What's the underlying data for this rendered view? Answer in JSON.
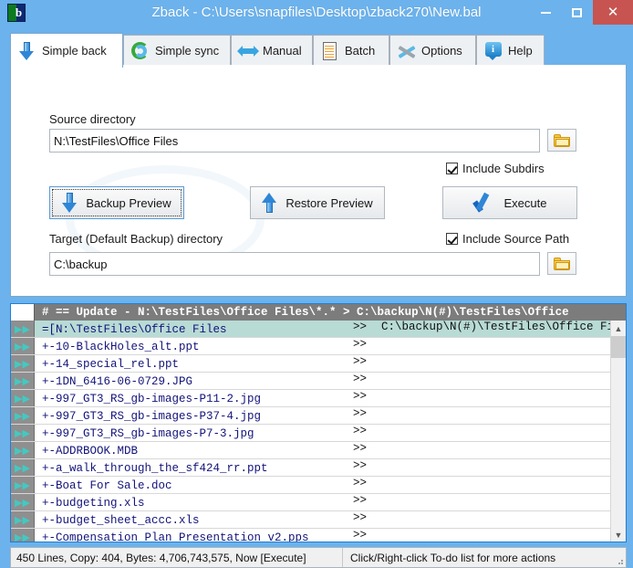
{
  "window": {
    "title": "Zback - C:\\Users\\snapfiles\\Desktop\\zback270\\New.bal",
    "minimize_label": "–",
    "maximize_label": "□",
    "close_label": "✕",
    "app_icon": "zback-app-icon"
  },
  "tabs": [
    {
      "label": "Simple back",
      "icon": "down-arrow-icon",
      "active": true
    },
    {
      "label": "Simple sync",
      "icon": "sync-arrows-icon",
      "active": false
    },
    {
      "label": "Manual",
      "icon": "left-right-arrow-icon",
      "active": false
    },
    {
      "label": "Batch",
      "icon": "document-list-icon",
      "active": false
    },
    {
      "label": "Options",
      "icon": "tools-icon",
      "active": false
    },
    {
      "label": "Help",
      "icon": "info-balloon-icon",
      "active": false
    }
  ],
  "form": {
    "source_label": "Source directory",
    "source_value": "N:\\TestFiles\\Office Files",
    "source_placeholder": "Source directory",
    "browse_icon": "folder-icon",
    "include_subdirs_label": "Include Subdirs",
    "include_subdirs_checked": true,
    "backup_preview_label": "Backup Preview",
    "backup_preview_icon": "down-arrow-icon",
    "restore_preview_label": "Restore Preview",
    "restore_preview_icon": "up-arrow-icon",
    "execute_label": "Execute",
    "execute_icon": "blue-check-icon",
    "target_label": "Target (Default Backup) directory",
    "target_value": "C:\\backup",
    "target_placeholder": "Target (Default Backup) directory",
    "include_source_path_label": "Include Source Path",
    "include_source_path_checked": true
  },
  "todo_list": {
    "header": "# == Update - N:\\TestFiles\\Office Files\\*.* > C:\\backup\\N(#)\\TestFiles\\Office",
    "rows": [
      {
        "gutter": "▶▶",
        "name": "=[N:\\TestFiles\\Office Files",
        "arrows": ">>",
        "dest": "C:\\backup\\N(#)\\TestFiles\\Office Files",
        "selected": true
      },
      {
        "gutter": "▶▶",
        "name": "+-10-BlackHoles_alt.ppt",
        "arrows": ">>",
        "dest": "",
        "selected": false
      },
      {
        "gutter": "▶▶",
        "name": "+-14_special_rel.ppt",
        "arrows": ">>",
        "dest": "",
        "selected": false
      },
      {
        "gutter": "▶▶",
        "name": "+-1DN_6416-06-0729.JPG",
        "arrows": ">>",
        "dest": "",
        "selected": false
      },
      {
        "gutter": "▶▶",
        "name": "+-997_GT3_RS_gb-images-P11-2.jpg",
        "arrows": ">>",
        "dest": "",
        "selected": false
      },
      {
        "gutter": "▶▶",
        "name": "+-997_GT3_RS_gb-images-P37-4.jpg",
        "arrows": ">>",
        "dest": "",
        "selected": false
      },
      {
        "gutter": "▶▶",
        "name": "+-997_GT3_RS_gb-images-P7-3.jpg",
        "arrows": ">>",
        "dest": "",
        "selected": false
      },
      {
        "gutter": "▶▶",
        "name": "+-ADDRBOOK.MDB",
        "arrows": ">>",
        "dest": "",
        "selected": false
      },
      {
        "gutter": "▶▶",
        "name": "+-a_walk_through_the_sf424_rr.ppt",
        "arrows": ">>",
        "dest": "",
        "selected": false
      },
      {
        "gutter": "▶▶",
        "name": "+-Boat For Sale.doc",
        "arrows": ">>",
        "dest": "",
        "selected": false
      },
      {
        "gutter": "▶▶",
        "name": "+-budgeting.xls",
        "arrows": ">>",
        "dest": "",
        "selected": false
      },
      {
        "gutter": "▶▶",
        "name": "+-budget_sheet_accc.xls",
        "arrows": ">>",
        "dest": "",
        "selected": false
      },
      {
        "gutter": "▶▶",
        "name": "+-Compensation_Plan_Presentation_v2.pps",
        "arrows": ">>",
        "dest": "",
        "selected": false
      }
    ],
    "scroll_up_icon": "chevron-up-icon",
    "scroll_down_icon": "chevron-down-icon"
  },
  "statusbar": {
    "left": "450  Lines, Copy: 404,  Bytes: 4,706,743,575, Now [Execute]",
    "right": "Click/Right-click To-do list for more actions"
  },
  "colors": {
    "window_frame": "#6cb2ec",
    "close_button": "#c75450",
    "list_border": "#1f7fd4",
    "selected_row": "#b8dbd5",
    "list_header": "#7c7c7c",
    "mono_text": "#13137a"
  }
}
